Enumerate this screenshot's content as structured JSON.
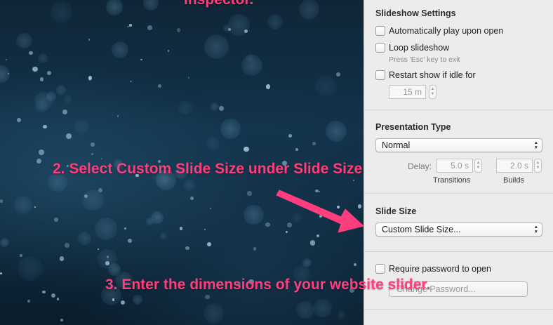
{
  "canvas": {
    "top_text": "Inspector."
  },
  "slideshow_settings": {
    "title": "Slideshow Settings",
    "autoplay_label": "Automatically play upon open",
    "loop_label": "Loop slideshow",
    "loop_hint": "Press 'Esc' key to exit",
    "restart_label": "Restart show if idle for",
    "idle_value": "15 m"
  },
  "presentation_type": {
    "title": "Presentation Type",
    "selected": "Normal",
    "delay_label": "Delay:",
    "transitions_value": "5.0 s",
    "transitions_label": "Transitions",
    "builds_value": "2.0 s",
    "builds_label": "Builds"
  },
  "slide_size": {
    "title": "Slide Size",
    "selected": "Custom Slide Size..."
  },
  "password": {
    "require_label": "Require password to open",
    "button_label": "Change Password..."
  },
  "annotations": {
    "step2": "2. Select Custom Slide Size under Slide Size",
    "step3": "3. Enter the dimensions of your website slider."
  },
  "colors": {
    "annotation": "#ff3e7d",
    "panel_bg": "#ececec"
  }
}
